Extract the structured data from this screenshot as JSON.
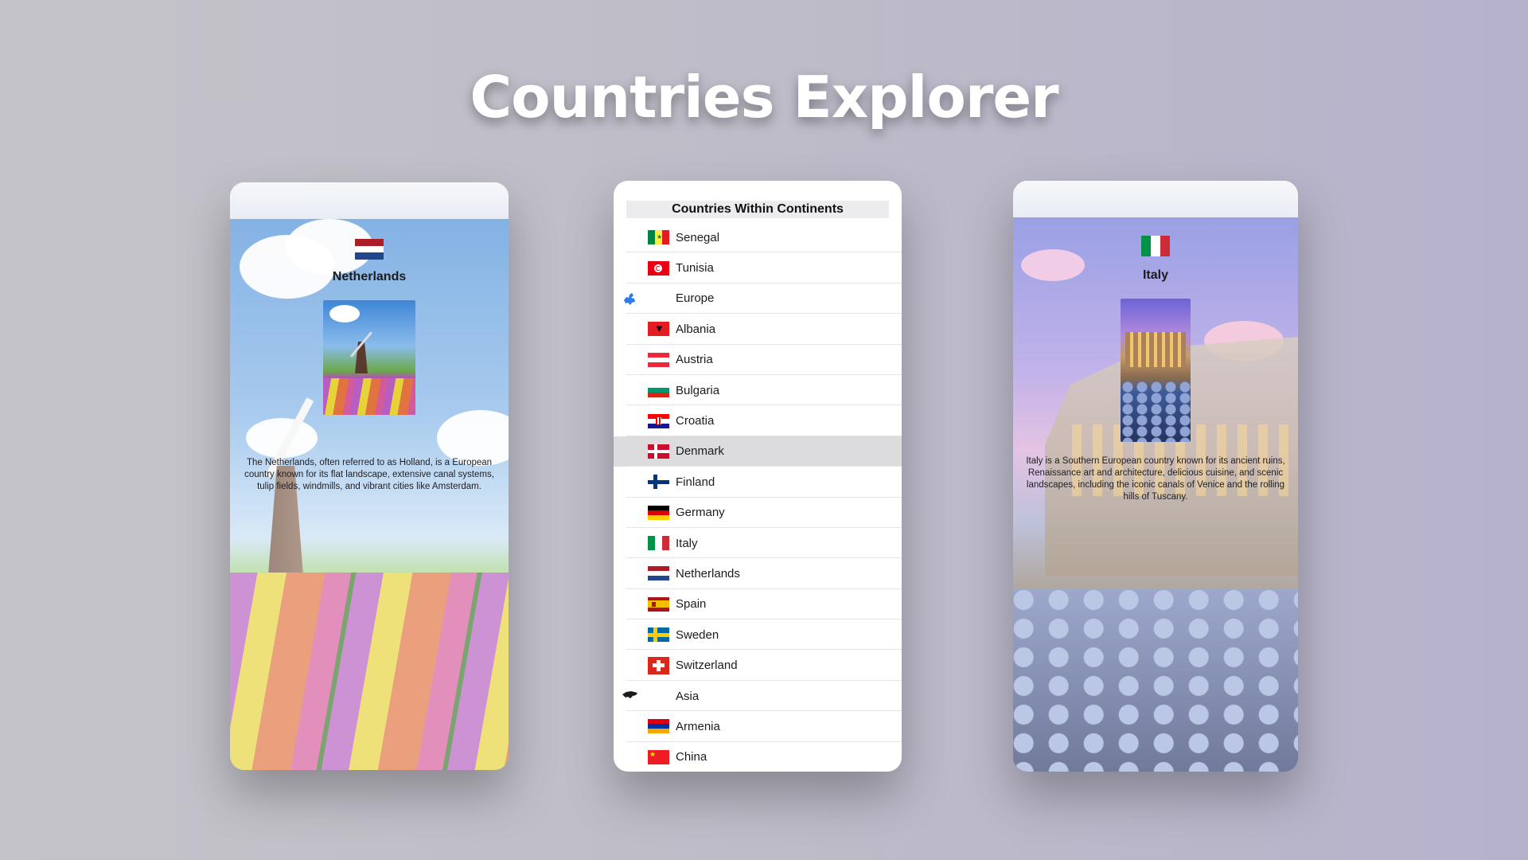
{
  "page": {
    "title": "Countries Explorer"
  },
  "left_detail": {
    "country": "Netherlands",
    "flag": "netherlands-flag",
    "description": "The Netherlands, often referred to as Holland, is a European country known for its flat landscape, extensive canal systems, tulip fields, windmills, and vibrant cities like Amsterdam."
  },
  "list": {
    "header": "Countries Within Continents",
    "rows": [
      {
        "label": "Senegal",
        "icon": "senegal-flag"
      },
      {
        "label": "Tunisia",
        "icon": "tunisia-flag"
      },
      {
        "label": "Europe",
        "icon": "europe-continent-icon"
      },
      {
        "label": "Albania",
        "icon": "albania-flag"
      },
      {
        "label": "Austria",
        "icon": "austria-flag"
      },
      {
        "label": "Bulgaria",
        "icon": "bulgaria-flag"
      },
      {
        "label": "Croatia",
        "icon": "croatia-flag"
      },
      {
        "label": "Denmark",
        "icon": "denmark-flag",
        "selected": true
      },
      {
        "label": "Finland",
        "icon": "finland-flag"
      },
      {
        "label": "Germany",
        "icon": "germany-flag"
      },
      {
        "label": "Italy",
        "icon": "italy-flag"
      },
      {
        "label": "Netherlands",
        "icon": "netherlands-flag"
      },
      {
        "label": "Spain",
        "icon": "spain-flag"
      },
      {
        "label": "Sweden",
        "icon": "sweden-flag"
      },
      {
        "label": "Switzerland",
        "icon": "switzerland-flag"
      },
      {
        "label": "Asia",
        "icon": "asia-continent-icon"
      },
      {
        "label": "Armenia",
        "icon": "armenia-flag"
      },
      {
        "label": "China",
        "icon": "china-flag"
      }
    ]
  },
  "right_detail": {
    "country": "Italy",
    "flag": "italy-flag",
    "description": "Italy is a Southern European country known for its ancient ruins, Renaissance art and architecture, delicious cuisine, and scenic landscapes, including the iconic canals of Venice and the rolling hills of Tuscany."
  },
  "colors": {
    "background": "#c0bfc9",
    "selected_row": "#dcdcdf",
    "title_text": "#ffffff"
  }
}
